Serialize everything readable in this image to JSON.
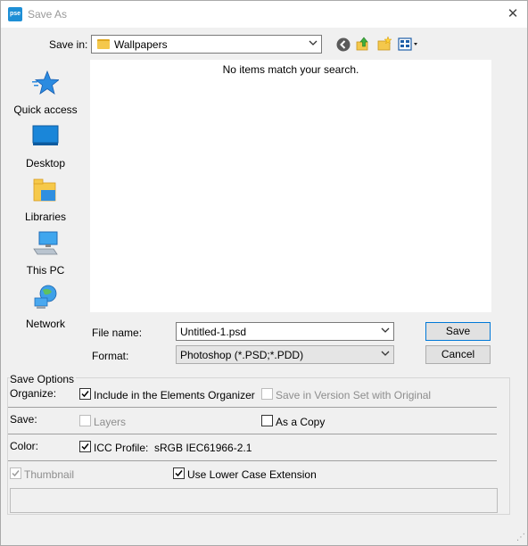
{
  "window": {
    "title": "Save As",
    "app_badge": "pse"
  },
  "toolbar": {
    "save_in_label": "Save in:",
    "save_in_value": "Wallpapers",
    "icons": [
      "back-icon",
      "up-folder-icon",
      "new-folder-icon",
      "view-menu-icon"
    ]
  },
  "places": [
    {
      "label": "Quick access",
      "icon": "star-icon"
    },
    {
      "label": "Desktop",
      "icon": "desktop-icon"
    },
    {
      "label": "Libraries",
      "icon": "libraries-icon"
    },
    {
      "label": "This PC",
      "icon": "computer-icon"
    },
    {
      "label": "Network",
      "icon": "network-icon"
    }
  ],
  "filelist": {
    "empty_message": "No items match your search."
  },
  "form": {
    "filename_label": "File name:",
    "filename_value": "Untitled-1.psd",
    "format_label": "Format:",
    "format_value": "Photoshop (*.PSD;*.PDD)",
    "save_button": "Save",
    "cancel_button": "Cancel"
  },
  "save_options": {
    "title": "Save Options",
    "organize_label": "Organize:",
    "include_organizer": {
      "label": "Include in the Elements Organizer",
      "checked": true,
      "enabled": true
    },
    "version_set": {
      "label": "Save in Version Set with Original",
      "checked": false,
      "enabled": false
    },
    "save_label": "Save:",
    "layers": {
      "label": "Layers",
      "checked": false,
      "enabled": false
    },
    "as_copy": {
      "label": "As a Copy",
      "checked": false,
      "enabled": true
    },
    "color_label": "Color:",
    "icc_profile": {
      "label": "ICC Profile:  sRGB IEC61966-2.1",
      "checked": true,
      "enabled": true
    },
    "thumbnail": {
      "label": "Thumbnail",
      "checked": true,
      "enabled": false
    },
    "lower_case": {
      "label": "Use Lower Case Extension",
      "checked": true,
      "enabled": true
    }
  },
  "colors": {
    "accent": "#0078d7",
    "folder": "#f4c84c",
    "app_badge": "#1e8fd6"
  }
}
